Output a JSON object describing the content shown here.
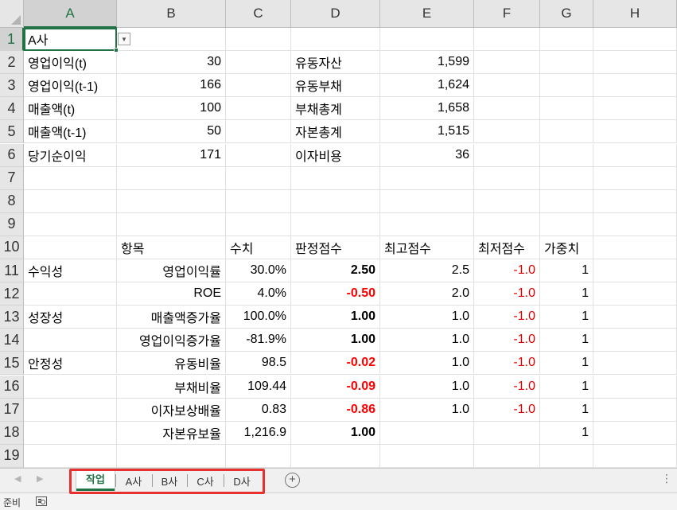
{
  "columns": [
    "A",
    "B",
    "C",
    "D",
    "E",
    "F",
    "G",
    "H"
  ],
  "rows": [
    "1",
    "2",
    "3",
    "4",
    "5",
    "6",
    "7",
    "8",
    "9",
    "10",
    "11",
    "12",
    "13",
    "14",
    "15",
    "16",
    "17",
    "18",
    "19"
  ],
  "cells": {
    "A1": "A사",
    "A2": "영업이익(t)",
    "B2": "30",
    "D2": "유동자산",
    "E2": "1,599",
    "A3": "영업이익(t-1)",
    "B3": "166",
    "D3": "유동부채",
    "E3": "1,624",
    "A4": "매출액(t)",
    "B4": "100",
    "D4": "부채총계",
    "E4": "1,658",
    "A5": "매출액(t-1)",
    "B5": "50",
    "D5": "자본총계",
    "E5": "1,515",
    "A6": "당기순이익",
    "B6": "171",
    "D6": "이자비용",
    "E6": "36",
    "B10": "항목",
    "C10": "수치",
    "D10": "판정점수",
    "E10": "최고점수",
    "F10": "최저점수",
    "G10": "가중치",
    "A11": "수익성",
    "B11": "영업이익률",
    "C11": "30.0%",
    "D11": "2.50",
    "E11": "2.5",
    "F11": "-1.0",
    "G11": "1",
    "B12": "ROE",
    "C12": "4.0%",
    "D12": "-0.50",
    "E12": "2.0",
    "F12": "-1.0",
    "G12": "1",
    "A13": "성장성",
    "B13": "매출액증가율",
    "C13": "100.0%",
    "D13": "1.00",
    "E13": "1.0",
    "F13": "-1.0",
    "G13": "1",
    "B14": "영업이익증가율",
    "C14": "-81.9%",
    "D14": "1.00",
    "E14": "1.0",
    "F14": "-1.0",
    "G14": "1",
    "A15": "안정성",
    "B15": "유동비율",
    "C15": "98.5",
    "D15": "-0.02",
    "E15": "1.0",
    "F15": "-1.0",
    "G15": "1",
    "B16": "부채비율",
    "C16": "109.44",
    "D16": "-0.09",
    "E16": "1.0",
    "F16": "-1.0",
    "G16": "1",
    "B17": "이자보상배율",
    "C17": "0.83",
    "D17": "-0.86",
    "E17": "1.0",
    "F17": "-1.0",
    "G17": "1",
    "B18": "자본유보율",
    "C18": "1,216.9",
    "D18": "1.00",
    "G18": "1"
  },
  "active_cell": "A1",
  "sheet_tabs": [
    "작업",
    "A사",
    "B사",
    "C사",
    "D사"
  ],
  "active_tab": "작업",
  "status": {
    "ready_text": "준비"
  },
  "icons": {
    "dropdown": "chevron-down-icon",
    "add_sheet": "plus-circle-icon",
    "tab_nav_prev": "triangle-left-icon",
    "tab_nav_next": "triangle-right-icon",
    "macro": "macro-record-icon"
  },
  "colors": {
    "accent": "#217346",
    "negative": "#ff0000",
    "tab_highlight_border": "#e8302e"
  }
}
